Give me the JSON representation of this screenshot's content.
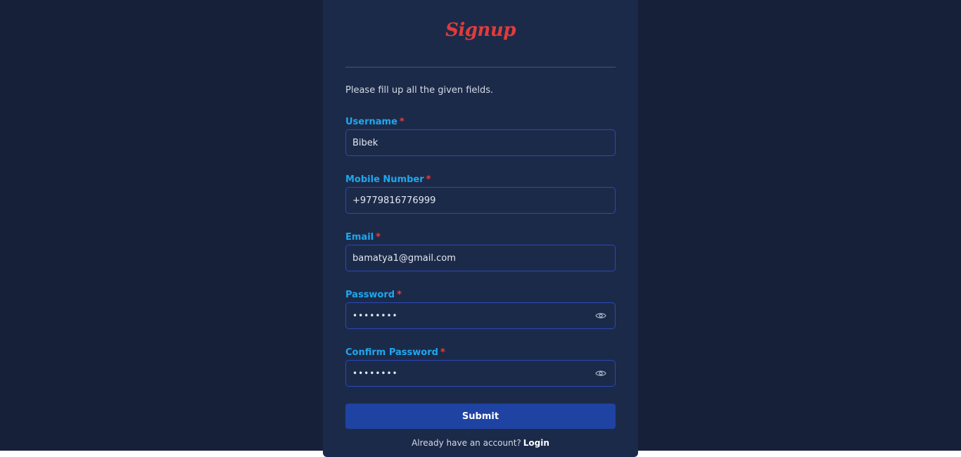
{
  "form": {
    "title": "Signup",
    "instructions": "Please fill up all the given fields.",
    "required_marker": "*",
    "fields": {
      "username": {
        "label": "Username",
        "value": "Bibek"
      },
      "mobile": {
        "label": "Mobile Number",
        "value": "+9779816776999"
      },
      "email": {
        "label": "Email",
        "value": "bamatya1@gmail.com"
      },
      "password": {
        "label": "Password",
        "value": "••••••••",
        "toggle_icon": "eye-icon"
      },
      "confirm_password": {
        "label": "Confirm Password",
        "value": "••••••••",
        "toggle_icon": "eye-icon"
      }
    },
    "submit_label": "Submit",
    "login_prompt": "Already have an account?",
    "login_link": "Login"
  },
  "colors": {
    "page_background": "#172039",
    "card_background": "#1c2a49",
    "label": "#1ea8ee",
    "required": "#ef3a3a",
    "title": "#e03c3c",
    "input_border": "#2b48b8",
    "button": "#1f43a3"
  }
}
